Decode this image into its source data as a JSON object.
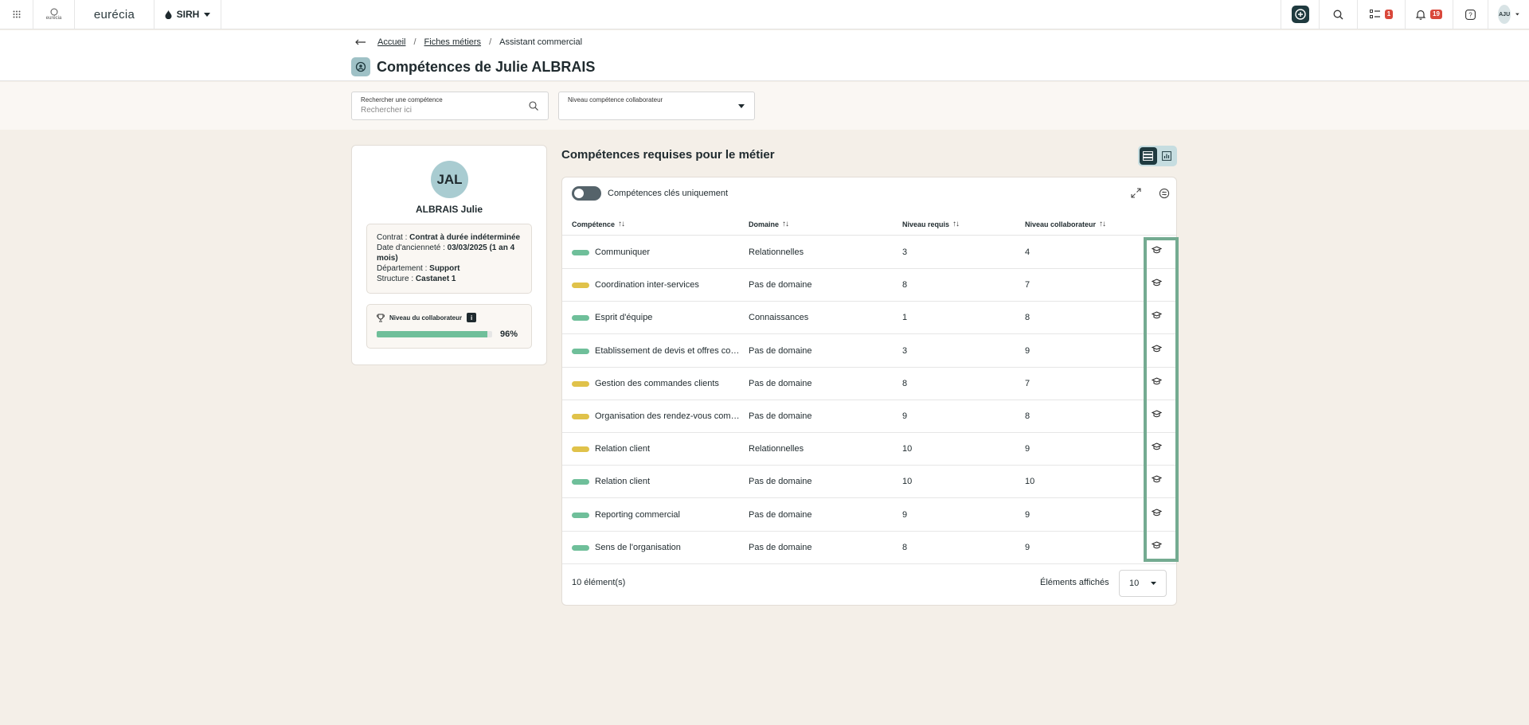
{
  "topbar": {
    "brand": "eurécia",
    "logo_text": "eurécia",
    "module": "SIRH",
    "tasks_badge": "1",
    "notifications_badge": "19",
    "user_initials": "AJU"
  },
  "breadcrumb": {
    "items": [
      "Accueil",
      "Fiches métiers",
      "Assistant commercial"
    ]
  },
  "page": {
    "title": "Compétences de Julie ALBRAIS"
  },
  "filters": {
    "search_label": "Rechercher une compétence",
    "search_placeholder": "Rechercher ici",
    "level_label": "Niveau compétence collaborateur"
  },
  "profile": {
    "initials": "JAL",
    "name": "ALBRAIS Julie",
    "contract_label": "Contrat : ",
    "contract_value": "Contrat à durée indéterminée",
    "seniority_label": "Date d'ancienneté : ",
    "seniority_value": "03/03/2025 (1 an 4 mois)",
    "department_label": "Département : ",
    "department_value": "Support",
    "structure_label": "Structure : ",
    "structure_value": "Castanet 1",
    "level_title": "Niveau du collaborateur",
    "level_percent": 96,
    "level_percent_text": "96%"
  },
  "skills": {
    "section_title": "Compétences requises pour le métier",
    "toggle_label": "Compétences clés uniquement",
    "columns": [
      "Compétence",
      "Domaine",
      "Niveau requis",
      "Niveau collaborateur"
    ],
    "rows": [
      {
        "status": "#6fbf9a",
        "name": "Communiquer",
        "domain": "Relationnelles",
        "required": "3",
        "level": "4"
      },
      {
        "status": "#e0c24a",
        "name": "Coordination inter-services",
        "domain": "Pas de domaine",
        "required": "8",
        "level": "7"
      },
      {
        "status": "#6fbf9a",
        "name": "Esprit d'équipe",
        "domain": "Connaissances",
        "required": "1",
        "level": "8"
      },
      {
        "status": "#6fbf9a",
        "name": "Etablissement de devis et offres commerciales",
        "domain": "Pas de domaine",
        "required": "3",
        "level": "9"
      },
      {
        "status": "#e0c24a",
        "name": "Gestion des commandes clients",
        "domain": "Pas de domaine",
        "required": "8",
        "level": "7"
      },
      {
        "status": "#e0c24a",
        "name": "Organisation des rendez-vous commerciaux",
        "domain": "Pas de domaine",
        "required": "9",
        "level": "8"
      },
      {
        "status": "#e0c24a",
        "name": "Relation client",
        "domain": "Relationnelles",
        "required": "10",
        "level": "9"
      },
      {
        "status": "#6fbf9a",
        "name": "Relation client",
        "domain": "Pas de domaine",
        "required": "10",
        "level": "10"
      },
      {
        "status": "#6fbf9a",
        "name": "Reporting commercial",
        "domain": "Pas de domaine",
        "required": "9",
        "level": "9"
      },
      {
        "status": "#6fbf9a",
        "name": "Sens de l'organisation",
        "domain": "Pas de domaine",
        "required": "8",
        "level": "9"
      }
    ],
    "count_text": "10 élément(s)",
    "per_page_label": "Éléments affichés",
    "per_page_value": "10"
  },
  "colors": {
    "accent_dark": "#1f3a3f",
    "ok": "#6fbf9a",
    "warning": "#e0c24a",
    "highlight": "#74ab91",
    "badge": "#d9483b"
  }
}
